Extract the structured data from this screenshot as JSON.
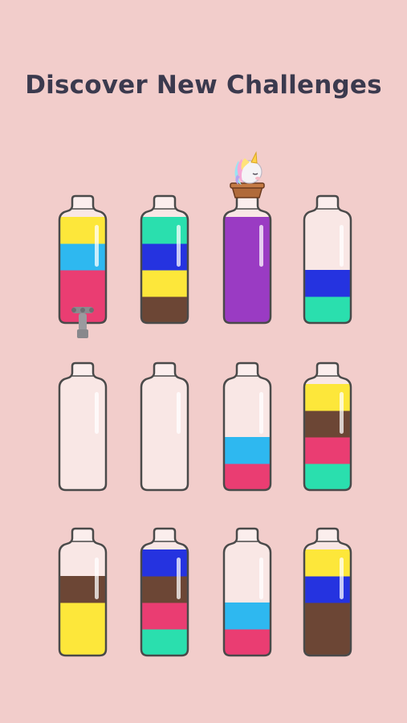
{
  "title": "Discover New Challenges",
  "colors": {
    "yellow": "#fde73a",
    "sky": "#2eb8f0",
    "pink": "#ea3d72",
    "teal": "#2adfae",
    "blue": "#2533e0",
    "brown": "#6c4635",
    "purple": "#9a3bc3",
    "glass": "#f9e7e5",
    "outline": "#4a4a4a"
  },
  "bottles": [
    {
      "name": "bottle-r1-c1",
      "layers": [
        "pink",
        "pink",
        "sky",
        "yellow"
      ],
      "accessory": "tap"
    },
    {
      "name": "bottle-r1-c2",
      "layers": [
        "brown",
        "yellow",
        "blue",
        "teal"
      ]
    },
    {
      "name": "bottle-r1-c3",
      "layers": [
        "purple",
        "purple",
        "purple",
        "purple"
      ],
      "accessory": "unicorn"
    },
    {
      "name": "bottle-r1-c4",
      "layers": [
        "teal",
        "blue"
      ]
    },
    {
      "name": "bottle-r2-c1",
      "layers": []
    },
    {
      "name": "bottle-r2-c2",
      "layers": []
    },
    {
      "name": "bottle-r2-c3",
      "layers": [
        "pink",
        "sky"
      ]
    },
    {
      "name": "bottle-r2-c4",
      "layers": [
        "teal",
        "pink",
        "brown",
        "yellow"
      ]
    },
    {
      "name": "bottle-r3-c1",
      "layers": [
        "yellow",
        "yellow",
        "brown"
      ]
    },
    {
      "name": "bottle-r3-c2",
      "layers": [
        "teal",
        "pink",
        "brown",
        "blue"
      ]
    },
    {
      "name": "bottle-r3-c3",
      "layers": [
        "pink",
        "sky"
      ]
    },
    {
      "name": "bottle-r3-c4",
      "layers": [
        "brown",
        "brown",
        "blue",
        "yellow"
      ]
    }
  ]
}
